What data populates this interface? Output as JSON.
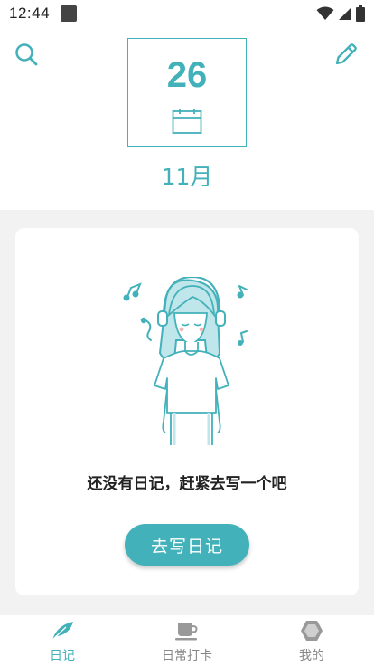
{
  "status_bar": {
    "time": "12:44"
  },
  "header": {
    "day": "26",
    "month": "11月",
    "search_icon": "search-icon",
    "edit_icon": "pencil-icon",
    "calendar_icon": "calendar-icon"
  },
  "empty_state": {
    "message": "还没有日记，赶紧去写一个吧",
    "button_label": "去写日记",
    "illustration": "girl-with-headphones-illustration"
  },
  "tabs": [
    {
      "label": "日记",
      "icon": "feather-icon",
      "active": true
    },
    {
      "label": "日常打卡",
      "icon": "coffee-cup-icon",
      "active": false
    },
    {
      "label": "我的",
      "icon": "hexagon-icon",
      "active": false
    }
  ],
  "colors": {
    "accent": "#43b1ba",
    "background": "#f2f2f2",
    "card": "#ffffff",
    "text": "#222222",
    "inactive": "#888888"
  }
}
